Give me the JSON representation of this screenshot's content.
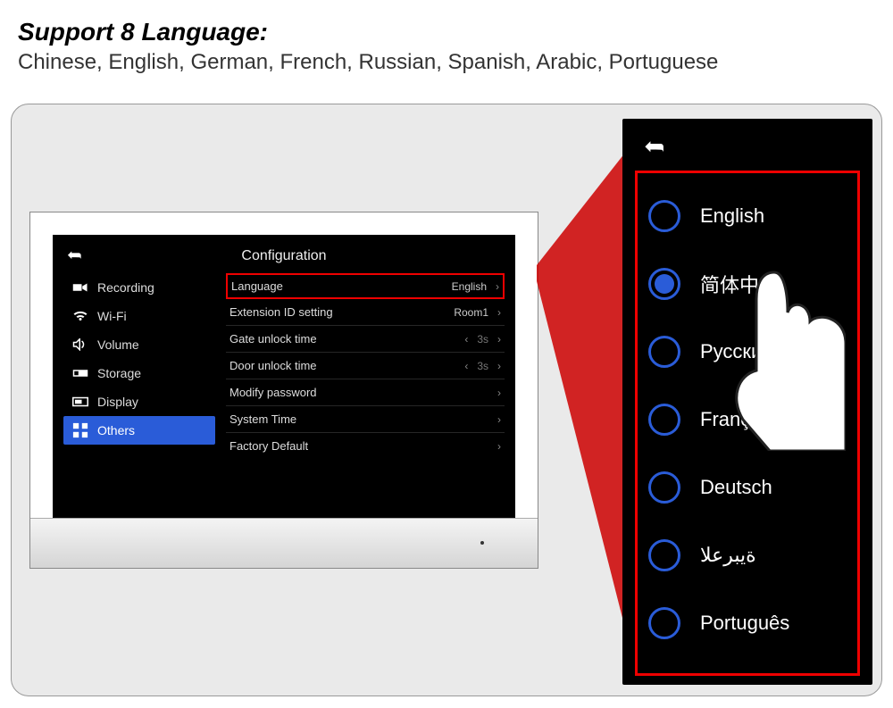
{
  "header": {
    "title": "Support 8 Language:",
    "subtitle": "Chinese, English, German, French, Russian, Spanish, Arabic, Portuguese"
  },
  "config": {
    "title": "Configuration",
    "sidebar": [
      {
        "icon": "camera",
        "label": "Recording"
      },
      {
        "icon": "wifi",
        "label": "Wi-Fi"
      },
      {
        "icon": "volume",
        "label": "Volume"
      },
      {
        "icon": "storage",
        "label": "Storage"
      },
      {
        "icon": "display",
        "label": "Display"
      },
      {
        "icon": "others",
        "label": "Others"
      }
    ],
    "rows": {
      "language": {
        "label": "Language",
        "value": "English"
      },
      "extension": {
        "label": "Extension ID setting",
        "value": "Room1"
      },
      "gate": {
        "label": "Gate unlock time",
        "value": "3s"
      },
      "door": {
        "label": "Door unlock time",
        "value": "3s"
      },
      "password": {
        "label": "Modify  password"
      },
      "systemtime": {
        "label": "System Time"
      },
      "factory": {
        "label": "Factory Default"
      }
    }
  },
  "languages": [
    {
      "label": "English",
      "selected": false
    },
    {
      "label": "简体中文",
      "selected": true
    },
    {
      "label": "Русский",
      "selected": false
    },
    {
      "label": "Français",
      "selected": false
    },
    {
      "label": "Deutsch",
      "selected": false
    },
    {
      "label": "ةيبرعلا",
      "selected": false
    },
    {
      "label": "Português",
      "selected": false
    }
  ]
}
